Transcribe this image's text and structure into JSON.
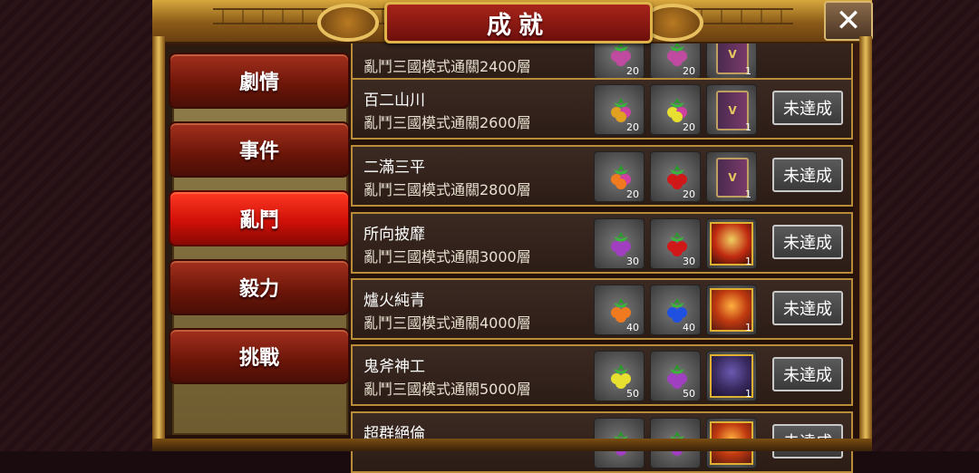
{
  "header": {
    "title": "成就",
    "close_icon": "close-icon"
  },
  "sidebar": {
    "tabs": [
      {
        "label": "劇情",
        "active": false
      },
      {
        "label": "事件",
        "active": false
      },
      {
        "label": "亂鬥",
        "active": true
      },
      {
        "label": "毅力",
        "active": false
      },
      {
        "label": "挑戰",
        "active": false
      }
    ]
  },
  "achievements": [
    {
      "title": "",
      "desc": "亂鬥三國模式通關2400層",
      "rewards": [
        {
          "type": "fruit",
          "colors": [
            "#c04aa0",
            "#c04aa0"
          ],
          "count": "20"
        },
        {
          "type": "fruit",
          "colors": [
            "#c04aa0",
            "#c04aa0"
          ],
          "count": "20"
        },
        {
          "type": "book",
          "count": "1"
        }
      ],
      "status": ""
    },
    {
      "title": "百二山川",
      "desc": "亂鬥三國模式通關2600層",
      "rewards": [
        {
          "type": "fruit",
          "colors": [
            "#e0a020",
            "#d040a0"
          ],
          "count": "20"
        },
        {
          "type": "fruit",
          "colors": [
            "#e8e030",
            "#d040a0"
          ],
          "count": "20"
        },
        {
          "type": "book",
          "count": "1"
        }
      ],
      "status": "未達成"
    },
    {
      "title": "二滿三平",
      "desc": "亂鬥三國模式通關2800層",
      "rewards": [
        {
          "type": "fruit",
          "colors": [
            "#f07a20",
            "#d040a0"
          ],
          "count": "20"
        },
        {
          "type": "fruit",
          "colors": [
            "#d01818",
            "#d01818"
          ],
          "count": "20"
        },
        {
          "type": "book",
          "count": "1"
        }
      ],
      "status": "未達成"
    },
    {
      "title": "所向披靡",
      "desc": "亂鬥三國模式通關3000層",
      "rewards": [
        {
          "type": "fruit",
          "colors": [
            "#a040c0",
            "#a040c0"
          ],
          "count": "30"
        },
        {
          "type": "fruit",
          "colors": [
            "#d01818",
            "#d01818"
          ],
          "count": "30"
        },
        {
          "type": "hero",
          "variant": "hero1",
          "count": "1"
        }
      ],
      "status": "未達成"
    },
    {
      "title": "爐火純青",
      "desc": "亂鬥三國模式通關4000層",
      "rewards": [
        {
          "type": "fruit",
          "colors": [
            "#f07a20",
            "#f07a20"
          ],
          "count": "40"
        },
        {
          "type": "fruit",
          "colors": [
            "#2050e0",
            "#2050e0"
          ],
          "count": "40"
        },
        {
          "type": "hero",
          "variant": "hero2",
          "count": "1"
        }
      ],
      "status": "未達成"
    },
    {
      "title": "鬼斧神工",
      "desc": "亂鬥三國模式通關5000層",
      "rewards": [
        {
          "type": "fruit",
          "colors": [
            "#e8e030",
            "#e8e030"
          ],
          "count": "50"
        },
        {
          "type": "fruit",
          "colors": [
            "#a040c0",
            "#a040c0"
          ],
          "count": "50"
        },
        {
          "type": "hero",
          "variant": "hero3",
          "count": "1"
        }
      ],
      "status": "未達成"
    },
    {
      "title": "超群絕倫",
      "desc": "",
      "rewards": [
        {
          "type": "fruit",
          "colors": [
            "#a040c0",
            "#a040c0"
          ],
          "count": ""
        },
        {
          "type": "fruit",
          "colors": [
            "#a040c0",
            "#a040c0"
          ],
          "count": ""
        },
        {
          "type": "hero",
          "variant": "hero2",
          "count": ""
        }
      ],
      "status": "未達成"
    }
  ]
}
